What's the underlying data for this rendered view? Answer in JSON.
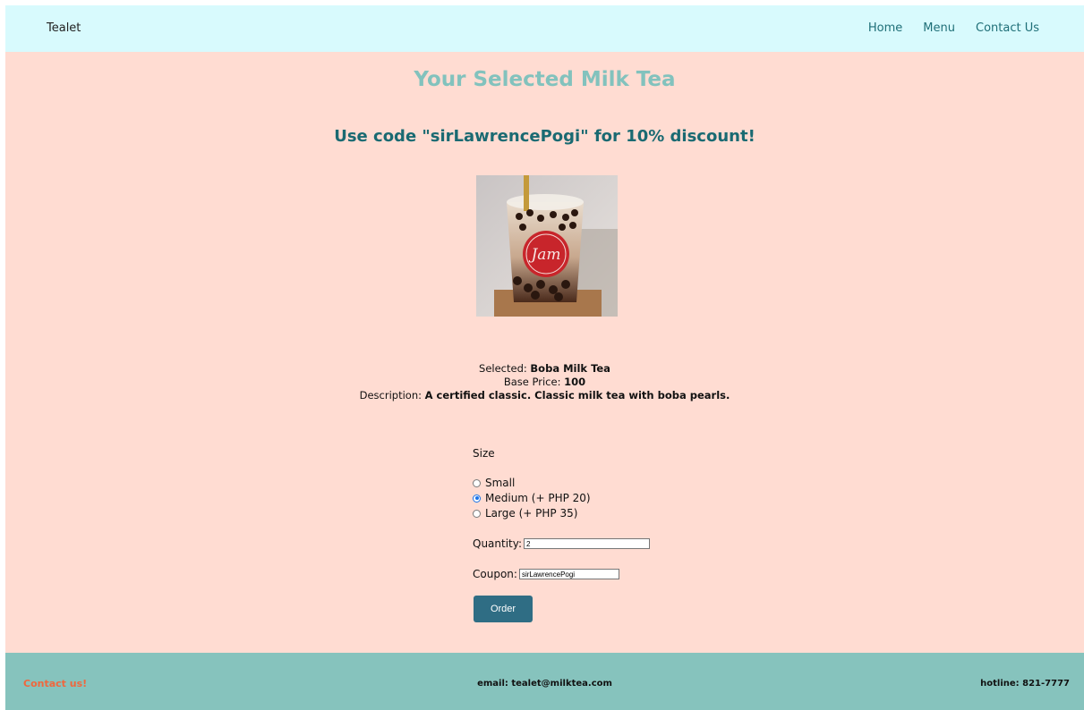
{
  "nav": {
    "brand": "Tealet",
    "links": [
      "Home",
      "Menu",
      "Contact Us"
    ]
  },
  "main": {
    "title": "Your Selected Milk Tea",
    "promo": "Use code \"sirLawrencePogi\" for 10% discount!",
    "image_alt": "boba-milk-tea",
    "details": {
      "selected_label": "Selected: ",
      "selected_value": "Boba Milk Tea",
      "price_label": "Base Price: ",
      "price_value": "100",
      "description_label": "Description: ",
      "description_value": "A certified classic. Classic milk tea with boba pearls."
    }
  },
  "form": {
    "size_label": "Size",
    "sizes": [
      {
        "label": "Small",
        "checked": false
      },
      {
        "label": "Medium (+ PHP 20)",
        "checked": true
      },
      {
        "label": "Large (+ PHP 35)",
        "checked": false
      }
    ],
    "quantity_label": "Quantity:",
    "quantity_value": "2",
    "coupon_label": "Coupon:",
    "coupon_value": "sirLawrencePogi",
    "order_label": "Order"
  },
  "footer": {
    "contact": "Contact us!",
    "email": "email: tealet@milktea.com",
    "hotline": "hotline: 821-7777"
  },
  "colors": {
    "page_bg": "#ffdcd2",
    "nav_bg": "#d8fafd",
    "footer_bg": "#86c3bd",
    "title": "#82c2bd",
    "promo": "#1a6a72",
    "button": "#2f6d84",
    "contact": "#f0673d"
  }
}
